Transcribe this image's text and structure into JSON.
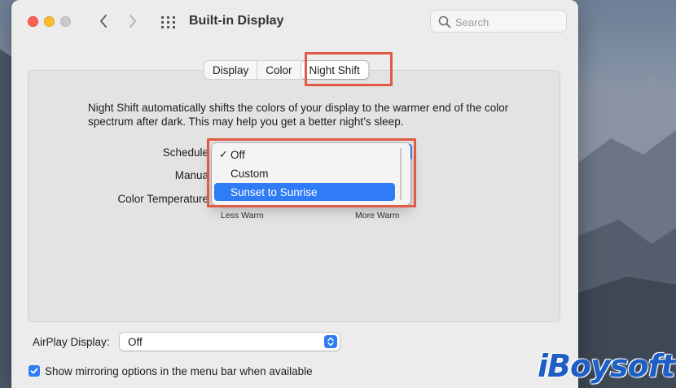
{
  "window": {
    "title": "Built-in Display"
  },
  "search": {
    "placeholder": "Search"
  },
  "tabs": [
    {
      "label": "Display"
    },
    {
      "label": "Color"
    },
    {
      "label": "Night Shift",
      "active": true
    }
  ],
  "night_shift": {
    "description": "Night Shift automatically shifts the colors of your display to the warmer end of the color spectrum after dark. This may help you get a better night’s sleep.",
    "schedule_label": "Schedule",
    "manual_label": "Manua",
    "color_temperature_label": "Color Temperature",
    "slider_min_label": "Less Warm",
    "slider_max_label": "More Warm",
    "schedule_menu": {
      "options": [
        {
          "label": "Off",
          "checked": true
        },
        {
          "label": "Custom"
        },
        {
          "label": "Sunset to Sunrise",
          "highlighted": true
        }
      ]
    }
  },
  "airplay": {
    "label": "AirPlay Display:",
    "value": "Off"
  },
  "mirroring": {
    "label": "Show mirroring options in the menu bar when available",
    "checked": true
  },
  "watermark": {
    "text": "iBoysoft"
  },
  "colors": {
    "accent": "#2f7cf6",
    "highlight_box": "#e05a45",
    "window_bg": "#ececec"
  }
}
